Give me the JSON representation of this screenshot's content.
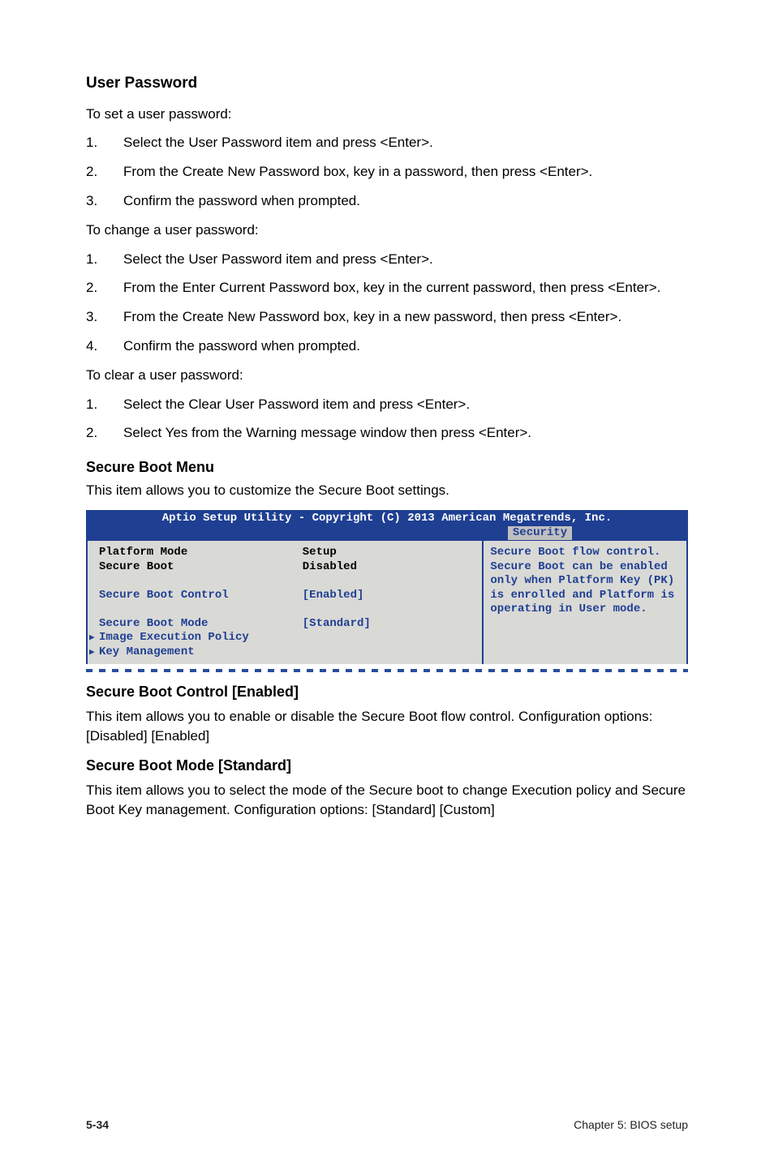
{
  "s1": {
    "h": "User Password",
    "p0": "To set a user password:",
    "l1": [
      {
        "n": "1.",
        "t": "Select the User Password item and press <Enter>."
      },
      {
        "n": "2.",
        "t": "From the Create New Password box, key in a password, then press <Enter>."
      },
      {
        "n": "3.",
        "t": "Confirm the password when prompted."
      }
    ],
    "p1": "To change a user password:",
    "l2": [
      {
        "n": "1.",
        "t": "Select the User Password item and press <Enter>."
      },
      {
        "n": "2.",
        "t": "From the Enter Current Password box, key in the current password, then press <Enter>."
      },
      {
        "n": "3.",
        "t": "From the Create New Password box, key in a new password, then press <Enter>."
      },
      {
        "n": "4.",
        "t": "Confirm the password when prompted."
      }
    ],
    "p2": "To clear a user password:",
    "l3": [
      {
        "n": "1.",
        "t": "Select the Clear User Password item and press <Enter>."
      },
      {
        "n": "2.",
        "t": "Select Yes from the Warning message window then press <Enter>."
      }
    ]
  },
  "s2": {
    "h": "Secure Boot Menu",
    "p": "This item allows you to customize the Secure Boot settings."
  },
  "bios": {
    "title": "Aptio Setup Utility - Copyright (C) 2013 American Megatrends, Inc.",
    "tab": "Security",
    "rows": [
      {
        "label": "Platform Mode",
        "value": "Setup",
        "cls": "black"
      },
      {
        "label": "Secure Boot",
        "value": "Disabled",
        "cls": "black"
      },
      {
        "label": "",
        "value": "",
        "cls": "black",
        "spacer": true
      },
      {
        "label": "Secure Boot Control",
        "value": "[Enabled]",
        "cls": "blue"
      },
      {
        "label": "",
        "value": "",
        "cls": "black",
        "spacer": true
      },
      {
        "label": "Secure Boot Mode",
        "value": "[Standard]",
        "cls": "blue"
      },
      {
        "label": "Image Execution Policy",
        "value": "",
        "cls": "blue",
        "arrow": true
      },
      {
        "label": "Key Management",
        "value": "",
        "cls": "blue",
        "arrow": true
      }
    ],
    "help": "Secure Boot flow control. Secure Boot can be enabled only when Platform Key (PK) is enrolled and Platform is operating in User mode."
  },
  "s3": {
    "h": "Secure Boot Control [Enabled]",
    "p": "This item allows you to enable or disable the Secure Boot flow control. Configuration options: [Disabled] [Enabled]"
  },
  "s4": {
    "h": "Secure Boot Mode [Standard]",
    "p": "This item allows you to select the mode of the Secure boot to change Execution policy and Secure Boot Key management. Configuration options: [Standard] [Custom]"
  },
  "footer": {
    "page": "5-34",
    "chap": "Chapter 5: BIOS setup"
  }
}
